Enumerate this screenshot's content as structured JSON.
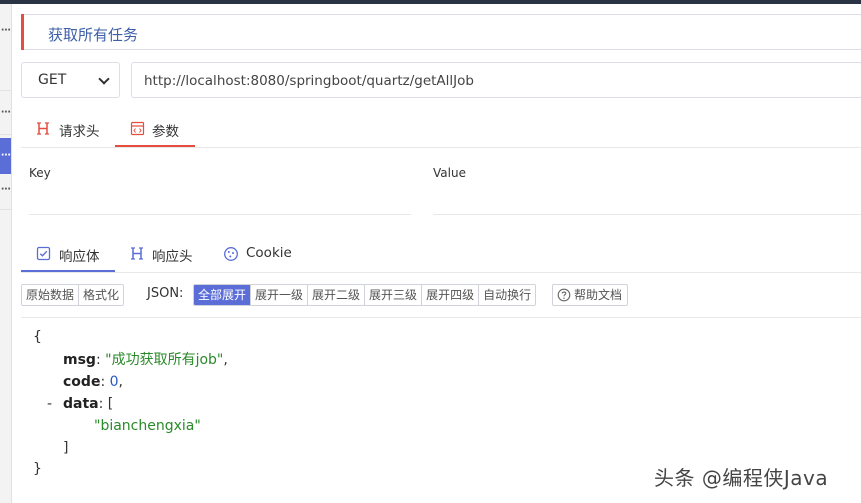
{
  "request": {
    "name": "获取所有任务",
    "method": "GET",
    "url": "http://localhost:8080/springboot/quartz/getAllJob"
  },
  "request_tabs": [
    {
      "label": "请求头",
      "icon": "header-icon"
    },
    {
      "label": "参数",
      "icon": "code-doc-icon"
    }
  ],
  "params": {
    "key_header": "Key",
    "value_header": "Value"
  },
  "response_tabs": [
    {
      "label": "响应体",
      "icon": "checkbox-icon"
    },
    {
      "label": "响应头",
      "icon": "header-icon"
    },
    {
      "label": "Cookie",
      "icon": "cookie-icon"
    }
  ],
  "view_mode": [
    "原始数据",
    "格式化"
  ],
  "json_label": "JSON:",
  "expand_options": [
    "全部展开",
    "展开一级",
    "展开二级",
    "展开三级",
    "展开四级",
    "自动换行"
  ],
  "help_label": "帮助文档",
  "response_json": {
    "open_brace": "{",
    "msg_key": "msg",
    "msg_value": "\"成功获取所有job\"",
    "code_key": "code",
    "code_value": "0",
    "data_key": "data",
    "data_open": "[",
    "collapse_toggle": "-",
    "data_item": "\"bianchengxia\"",
    "data_close": "]",
    "close_brace": "}"
  },
  "watermark": "头条 @编程侠Java",
  "colors": {
    "accent_red": "#e44d40",
    "accent_blue": "#5b6dd6",
    "string_green": "#2a8a2a",
    "number_blue": "#2a58c8"
  }
}
